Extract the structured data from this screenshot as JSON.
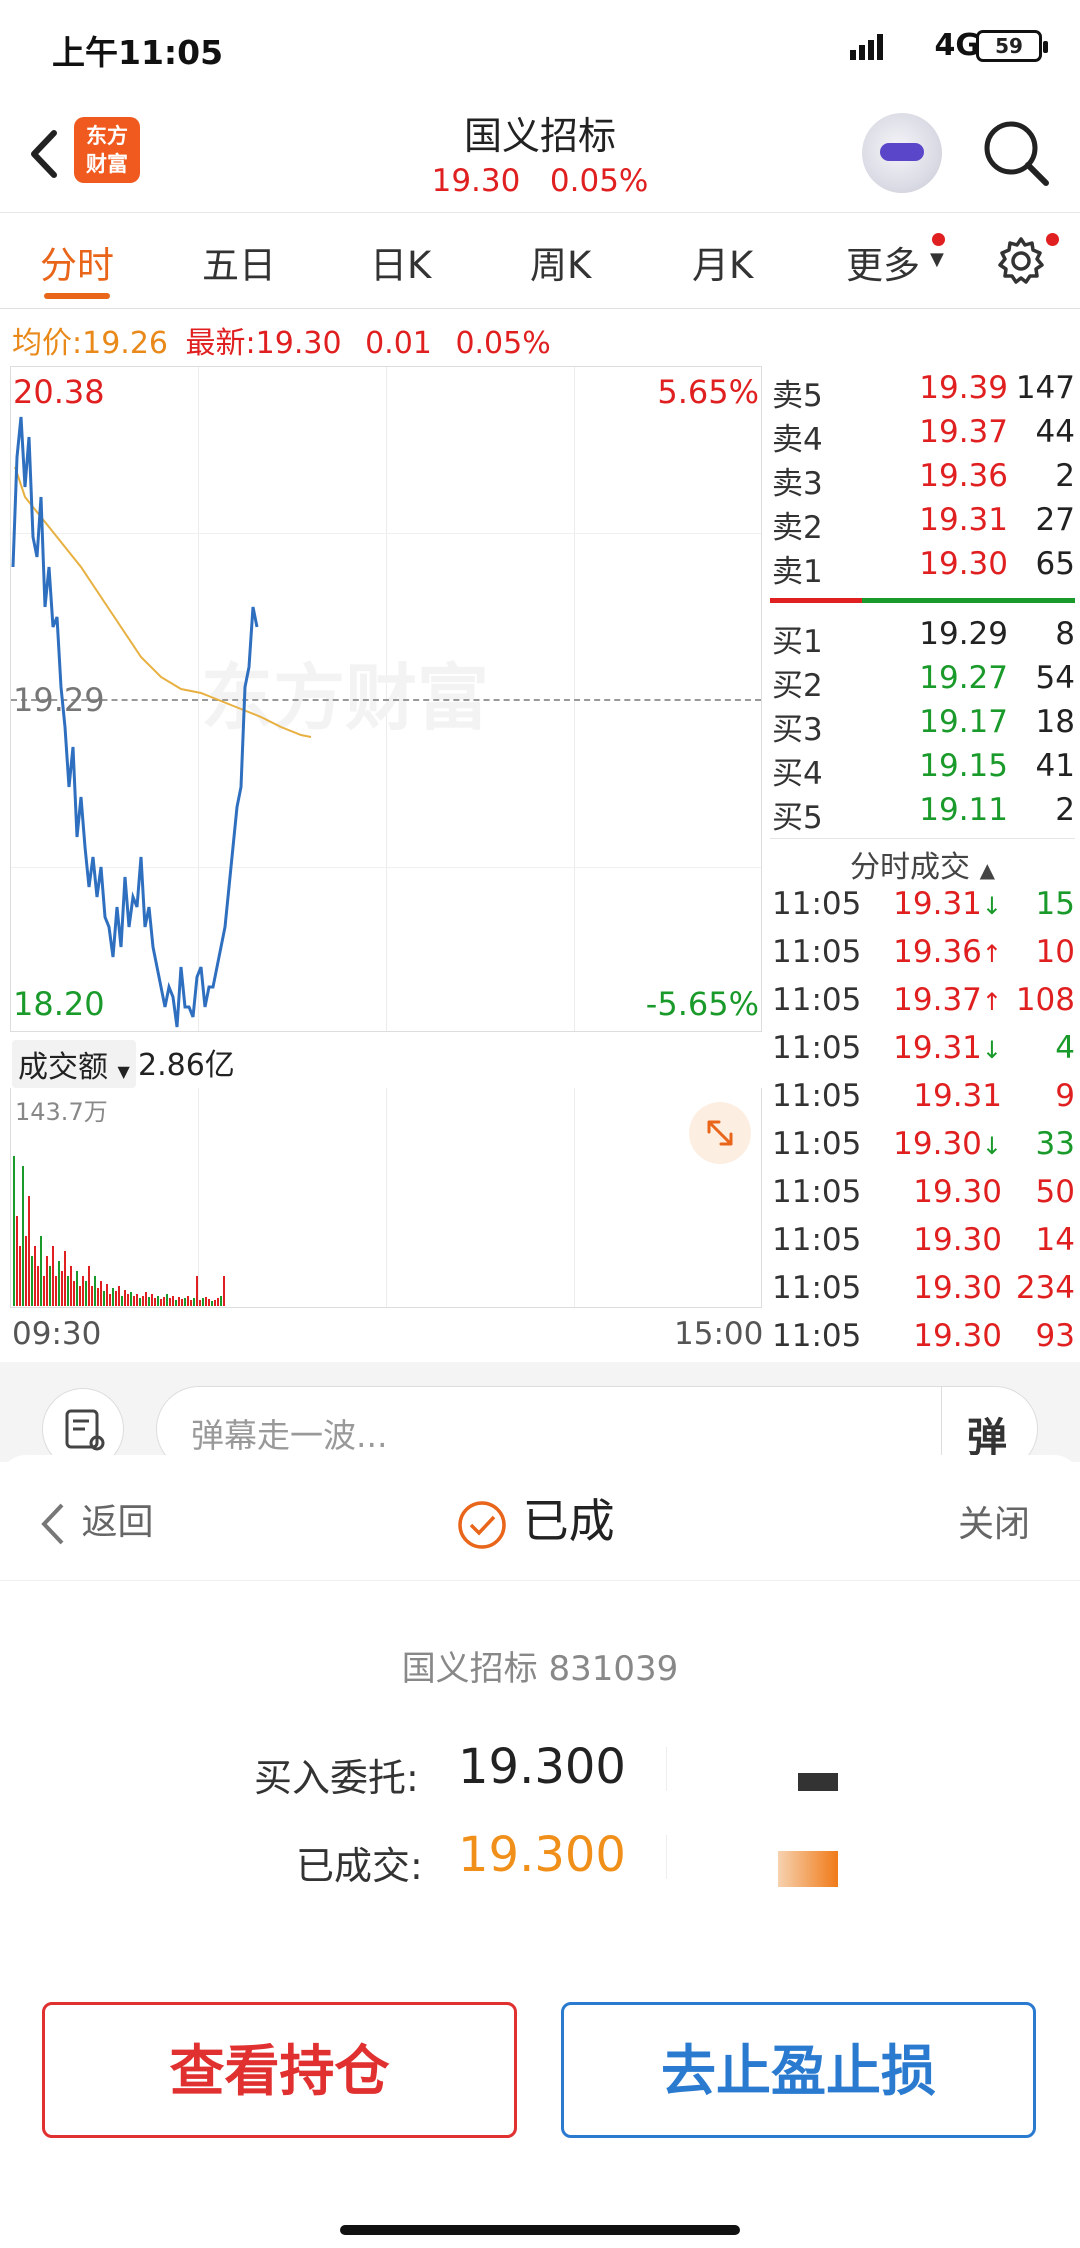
{
  "status_bar": {
    "time": "上午11:05",
    "network": "4G",
    "battery": "59"
  },
  "header": {
    "logo_text_line1": "东方",
    "logo_text_line2": "财富",
    "title": "国义招标",
    "price": "19.30",
    "change_pct": "0.05%"
  },
  "tabs": [
    {
      "label": "分时",
      "active": true
    },
    {
      "label": "五日"
    },
    {
      "label": "日K"
    },
    {
      "label": "周K"
    },
    {
      "label": "月K"
    },
    {
      "label": "更多"
    }
  ],
  "info_line": {
    "avg_label": "均价:",
    "avg_value": "19.26",
    "latest_label": "最新:",
    "latest_value": "19.30",
    "change": "0.01",
    "change_pct": "0.05%"
  },
  "chart": {
    "high_price": "20.38",
    "low_price": "18.20",
    "high_pct": "5.65%",
    "low_pct": "-5.65%",
    "ref_price": "19.29",
    "watermark": "东方财富",
    "turnover_label": "成交额",
    "turnover_value": "2.86亿",
    "vol_max": "143.7万",
    "time_start": "09:30",
    "time_end": "15:00",
    "colors": {
      "price_line": "#2f6fbf",
      "avg_line": "#e8b040",
      "up": "#e02020",
      "down": "#1a9a2a"
    }
  },
  "order_book": {
    "asks": [
      {
        "label": "卖5",
        "price": "19.39",
        "qty": "147"
      },
      {
        "label": "卖4",
        "price": "19.37",
        "qty": "44"
      },
      {
        "label": "卖3",
        "price": "19.36",
        "qty": "2"
      },
      {
        "label": "卖2",
        "price": "19.31",
        "qty": "27"
      },
      {
        "label": "卖1",
        "price": "19.30",
        "qty": "65"
      }
    ],
    "bids": [
      {
        "label": "买1",
        "price": "19.29",
        "qty": "8"
      },
      {
        "label": "买2",
        "price": "19.27",
        "qty": "54"
      },
      {
        "label": "买3",
        "price": "19.17",
        "qty": "18"
      },
      {
        "label": "买4",
        "price": "19.15",
        "qty": "41"
      },
      {
        "label": "买5",
        "price": "19.11",
        "qty": "2"
      }
    ]
  },
  "ticks_title": "分时成交",
  "ticks": [
    {
      "time": "11:05",
      "price": "19.31",
      "arrow": "↓",
      "qty": "15"
    },
    {
      "time": "11:05",
      "price": "19.36",
      "arrow": "↑",
      "qty": "10"
    },
    {
      "time": "11:05",
      "price": "19.37",
      "arrow": "↑",
      "qty": "108"
    },
    {
      "time": "11:05",
      "price": "19.31",
      "arrow": "↓",
      "qty": "4"
    },
    {
      "time": "11:05",
      "price": "19.31",
      "arrow": "",
      "qty": "9"
    },
    {
      "time": "11:05",
      "price": "19.30",
      "arrow": "↓",
      "qty": "33"
    },
    {
      "time": "11:05",
      "price": "19.30",
      "arrow": "",
      "qty": "50"
    },
    {
      "time": "11:05",
      "price": "19.30",
      "arrow": "",
      "qty": "14"
    },
    {
      "time": "11:05",
      "price": "19.30",
      "arrow": "",
      "qty": "234"
    },
    {
      "time": "11:05",
      "price": "19.30",
      "arrow": "",
      "qty": "93"
    }
  ],
  "danmu": {
    "placeholder": "弹幕走一波...",
    "button": "弹"
  },
  "sheet": {
    "back_label": "返回",
    "status_label": "已成",
    "close_label": "关闭",
    "stock_line": "国义招标 831039",
    "order_label": "买入委托:",
    "order_price": "19.300",
    "filled_label": "已成交:",
    "filled_price": "19.300",
    "btn_position": "查看持仓",
    "btn_stop": "去止盈止损"
  }
}
